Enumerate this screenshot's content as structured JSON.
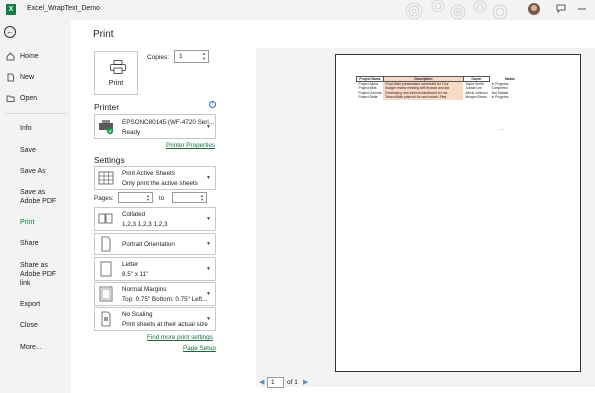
{
  "title_bar": {
    "app_icon_letter": "X",
    "doc_title": "Excel_WrapText_Demo",
    "icons": [
      "avatar",
      "feedback-icon",
      "minimize-icon"
    ]
  },
  "nav": {
    "items": [
      {
        "label": "Home",
        "icon": "home-icon"
      },
      {
        "label": "New",
        "icon": "new-file-icon"
      },
      {
        "label": "Open",
        "icon": "folder-icon"
      },
      {
        "label": "Info"
      },
      {
        "label": "Save"
      },
      {
        "label": "Save As"
      },
      {
        "label": "Save as Adobe PDF"
      },
      {
        "label": "Print"
      },
      {
        "label": "Share"
      },
      {
        "label": "Share as Adobe PDF link"
      },
      {
        "label": "Export"
      },
      {
        "label": "Close"
      },
      {
        "label": "More..."
      }
    ]
  },
  "print": {
    "title": "Print",
    "button_label": "Print",
    "copies_label": "Copies:",
    "copies_value": "1",
    "printer_heading": "Printer",
    "printer_name": "EPSONC80145 (WF-4720 Seri...",
    "printer_status": "Ready",
    "printer_properties_link": "Printer Properties",
    "settings_heading": "Settings",
    "settings": {
      "sheets_line1": "Print Active Sheets",
      "sheets_line2": "Only print the active sheets",
      "pages_label": "Pages:",
      "to_label": "to",
      "collated_line1": "Collated",
      "collated_line2": "1,2,3    1,2,3    1,2,3",
      "orientation": "Portrait Orientation",
      "paper_line1": "Letter",
      "paper_line2": "8.5\" x 11\"",
      "margins_line1": "Normal Margins",
      "margins_line2": "Top: 0.75\" Bottom: 0.75\" Left...",
      "scaling_line1": "No Scaling",
      "scaling_line2": "Print sheets at their actual size"
    },
    "more_settings_link": "Find more print settings",
    "page_setup_link": "Page Setup"
  },
  "preview": {
    "table": {
      "headers": [
        "Project Name",
        "Description",
        "Owner",
        "Status"
      ],
      "rows": [
        [
          "Project Alpha",
          "Final client presentation scheduled for Thur",
          "Taylor Smith",
          "In Progress"
        ],
        [
          "Project Beta",
          "Budget review meeting with finance and sta",
          "Jordan Lee",
          "Completed"
        ],
        [
          "Project Gamma",
          "Developing new internal dashboard for ma",
          "Alexis Johnson",
          "Not Started"
        ],
        [
          "Project Delta",
          "Team offsite planned for next month. Plea",
          "Morgan Brown",
          "In Progress"
        ]
      ]
    },
    "footer_text": "......",
    "current_page": "1",
    "of_text": "of 1"
  }
}
